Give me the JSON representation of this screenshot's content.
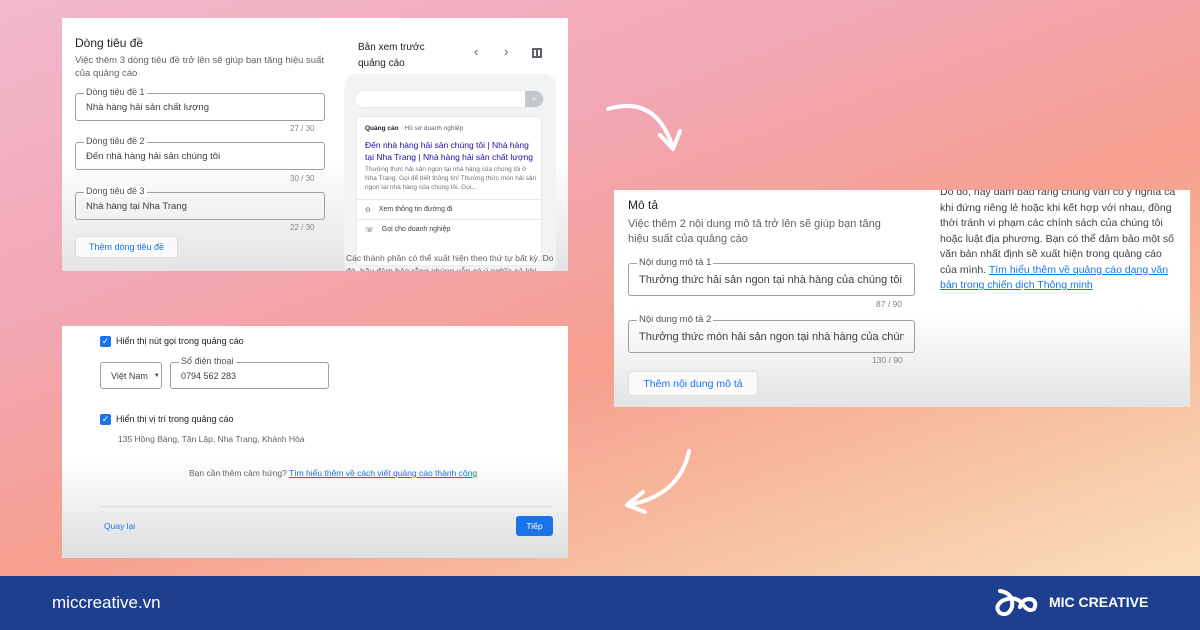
{
  "headlines": {
    "title": "Dòng tiêu đề",
    "subtitle": "Việc thêm 3 dòng tiêu đề trở lên sẽ giúp bạn tăng hiệu suất của quảng cáo",
    "fields": [
      {
        "label": "Dòng tiêu đề 1",
        "value": "Nhà hàng hải sản chất lượng",
        "count": "27 / 30"
      },
      {
        "label": "Dòng tiêu đề 2",
        "value": "Đến nhà hàng hải sản chúng tôi",
        "count": "30 / 30"
      },
      {
        "label": "Dòng tiêu đề 3",
        "value": "Nhà hàng tại Nha Trang",
        "count": "22 / 30"
      }
    ],
    "add_button": "Thêm dòng tiêu đề"
  },
  "preview": {
    "title": "Bản xem trước quảng cáo",
    "ad_label": "Quảng cáo",
    "ad_source": "· Hồ sơ doanh nghiệp",
    "ad_headline": "Đến nhà hàng hải sản chúng tôi | Nhà hàng tại Nha Trang | Nhà hàng hải sản chất lượng",
    "ad_desc": "Thưởng thức hải sản ngon tại nhà hàng của chúng tôi ở Nha Trang. Gọi để biết thông tin! Thưởng thức món hải sản ngon tại nhà hàng của chúng tôi. Gọi...",
    "action_directions": "Xem thông tin đường đi",
    "action_call": "Gọi cho doanh nghiệp",
    "note": "Các thành phần có thể xuất hiện theo thứ tự bất kỳ. Do đó, hãy đảm bảo rằng chúng vẫn có ý nghĩa cả khi"
  },
  "descriptions": {
    "title": "Mô tả",
    "subtitle": "Việc thêm 2 nội dung mô tả trở lên sẽ giúp bạn tăng hiệu suất của quảng cáo",
    "fields": [
      {
        "label": "Nội dung mô tả 1",
        "value": "Thưởng thức hải sản ngon tại nhà hàng của chúng tôi ở Nha T",
        "count": "87 / 90"
      },
      {
        "label": "Nội dung mô tả 2",
        "value": "Thưởng thức món hải sản ngon tại nhà hàng của chúng tôi. Gọ",
        "count": "130 / 90"
      }
    ],
    "add_button": "Thêm nội dung mô tả",
    "side_text": "Do đó, hãy đảm bảo rằng chúng vẫn có ý nghĩa cả khi đứng riêng lẻ hoặc khi kết hợp với nhau, đồng thời tránh vi phạm các chính sách của chúng tôi hoặc luật địa phương. Bạn có thể đảm bảo một số văn bản nhất định sẽ xuất hiện trong quảng cáo của mình. ",
    "side_link": "Tìm hiểu thêm về quảng cáo dạng văn bản trong chiến dịch Thông minh"
  },
  "contact": {
    "call_checkbox": "Hiển thị nút gọi trong quảng cáo",
    "country": "Việt Nam",
    "phone_label": "Số điện thoại",
    "phone": "0794 562 283",
    "location_checkbox": "Hiển thị vị trí trong quảng cáo",
    "address": "135 Hồng Bàng, Tân Lập, Nha Trang, Khánh Hòa",
    "inspiration": "Bạn cần thêm cảm hứng? ",
    "inspiration_link": "Tìm hiểu thêm về cách viết quảng cáo thành công",
    "back": "Quay lại",
    "next": "Tiếp"
  },
  "footer": {
    "website": "miccreative.vn",
    "brand": "MIC CREATIVE"
  },
  "colors": {
    "accent": "#1a73e8",
    "footer": "#1e3f8f"
  }
}
